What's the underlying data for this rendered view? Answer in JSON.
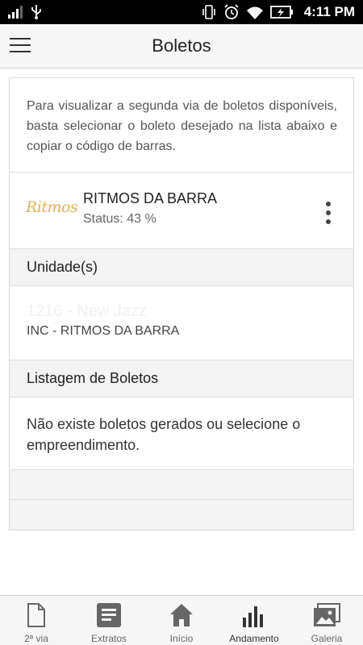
{
  "status_bar": {
    "time": "4:11 PM"
  },
  "app_bar": {
    "title": "Boletos"
  },
  "intro_text": "Para visualizar a segunda via de boletos disponíveis, basta selecionar o boleto desejado na lista abaixo e copiar o código de barras.",
  "enterprise": {
    "logo_text": "Ritmos",
    "name": "RITMOS DA BARRA",
    "status": "Status: 43 %"
  },
  "units_section": {
    "title": "Unidade(s)",
    "unit_faded": "1216 - New Jazz",
    "unit_name": "INC - RITMOS DA BARRA"
  },
  "boletos_section": {
    "title": "Listagem de Boletos",
    "empty_message": "Não existe boletos gerados ou selecione o empreendimento."
  },
  "bottom_nav": [
    {
      "label": "2ª via",
      "icon": "document-icon"
    },
    {
      "label": "Extratos",
      "icon": "list-icon"
    },
    {
      "label": "Início",
      "icon": "home-icon"
    },
    {
      "label": "Andamento",
      "icon": "bar-chart-icon",
      "active": true
    },
    {
      "label": "Galeria",
      "icon": "gallery-icon"
    }
  ],
  "colors": {
    "logo": "#e8b04c",
    "statusbar": "#000000",
    "appbar": "#f6f6f6",
    "section_bg": "#f3f3f3"
  }
}
